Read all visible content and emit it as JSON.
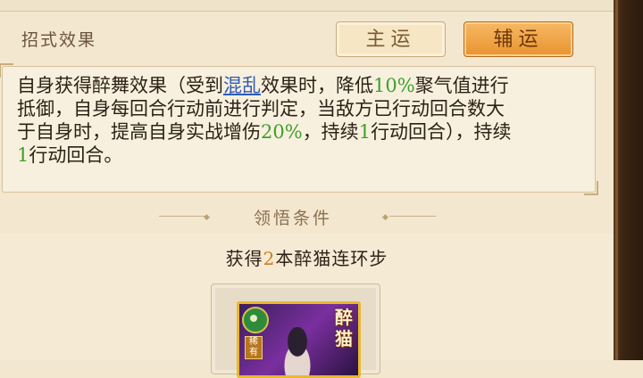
{
  "panel": {
    "section_title": "招式效果",
    "tabs": [
      {
        "label": "主运",
        "active": false
      },
      {
        "label": "辅运",
        "active": true
      }
    ]
  },
  "description": {
    "lines": [
      [
        "自身获得醉舞效果（受到",
        "混乱",
        "效果时，降低",
        "10%",
        "聚气值进行"
      ],
      [
        "抵御，自身每回合行动前进行判定，当敌方已行动回合数大"
      ],
      [
        "于自身时，提高自身实战增伤",
        "20%",
        "，持续",
        "1",
        "行动回合），持续"
      ],
      [
        "1",
        "行动回合。"
      ]
    ],
    "keyword_color": "#2f5bb3",
    "number_color": "#3ca02b"
  },
  "condition": {
    "title": "领悟条件",
    "prefix": "获得",
    "count": "2",
    "suffix": "本醉猫连环步",
    "count_color": "#d07a1c"
  },
  "card": {
    "title": "醉猫",
    "rarity": "稀有",
    "emblem_icon": "green-seal-icon"
  }
}
